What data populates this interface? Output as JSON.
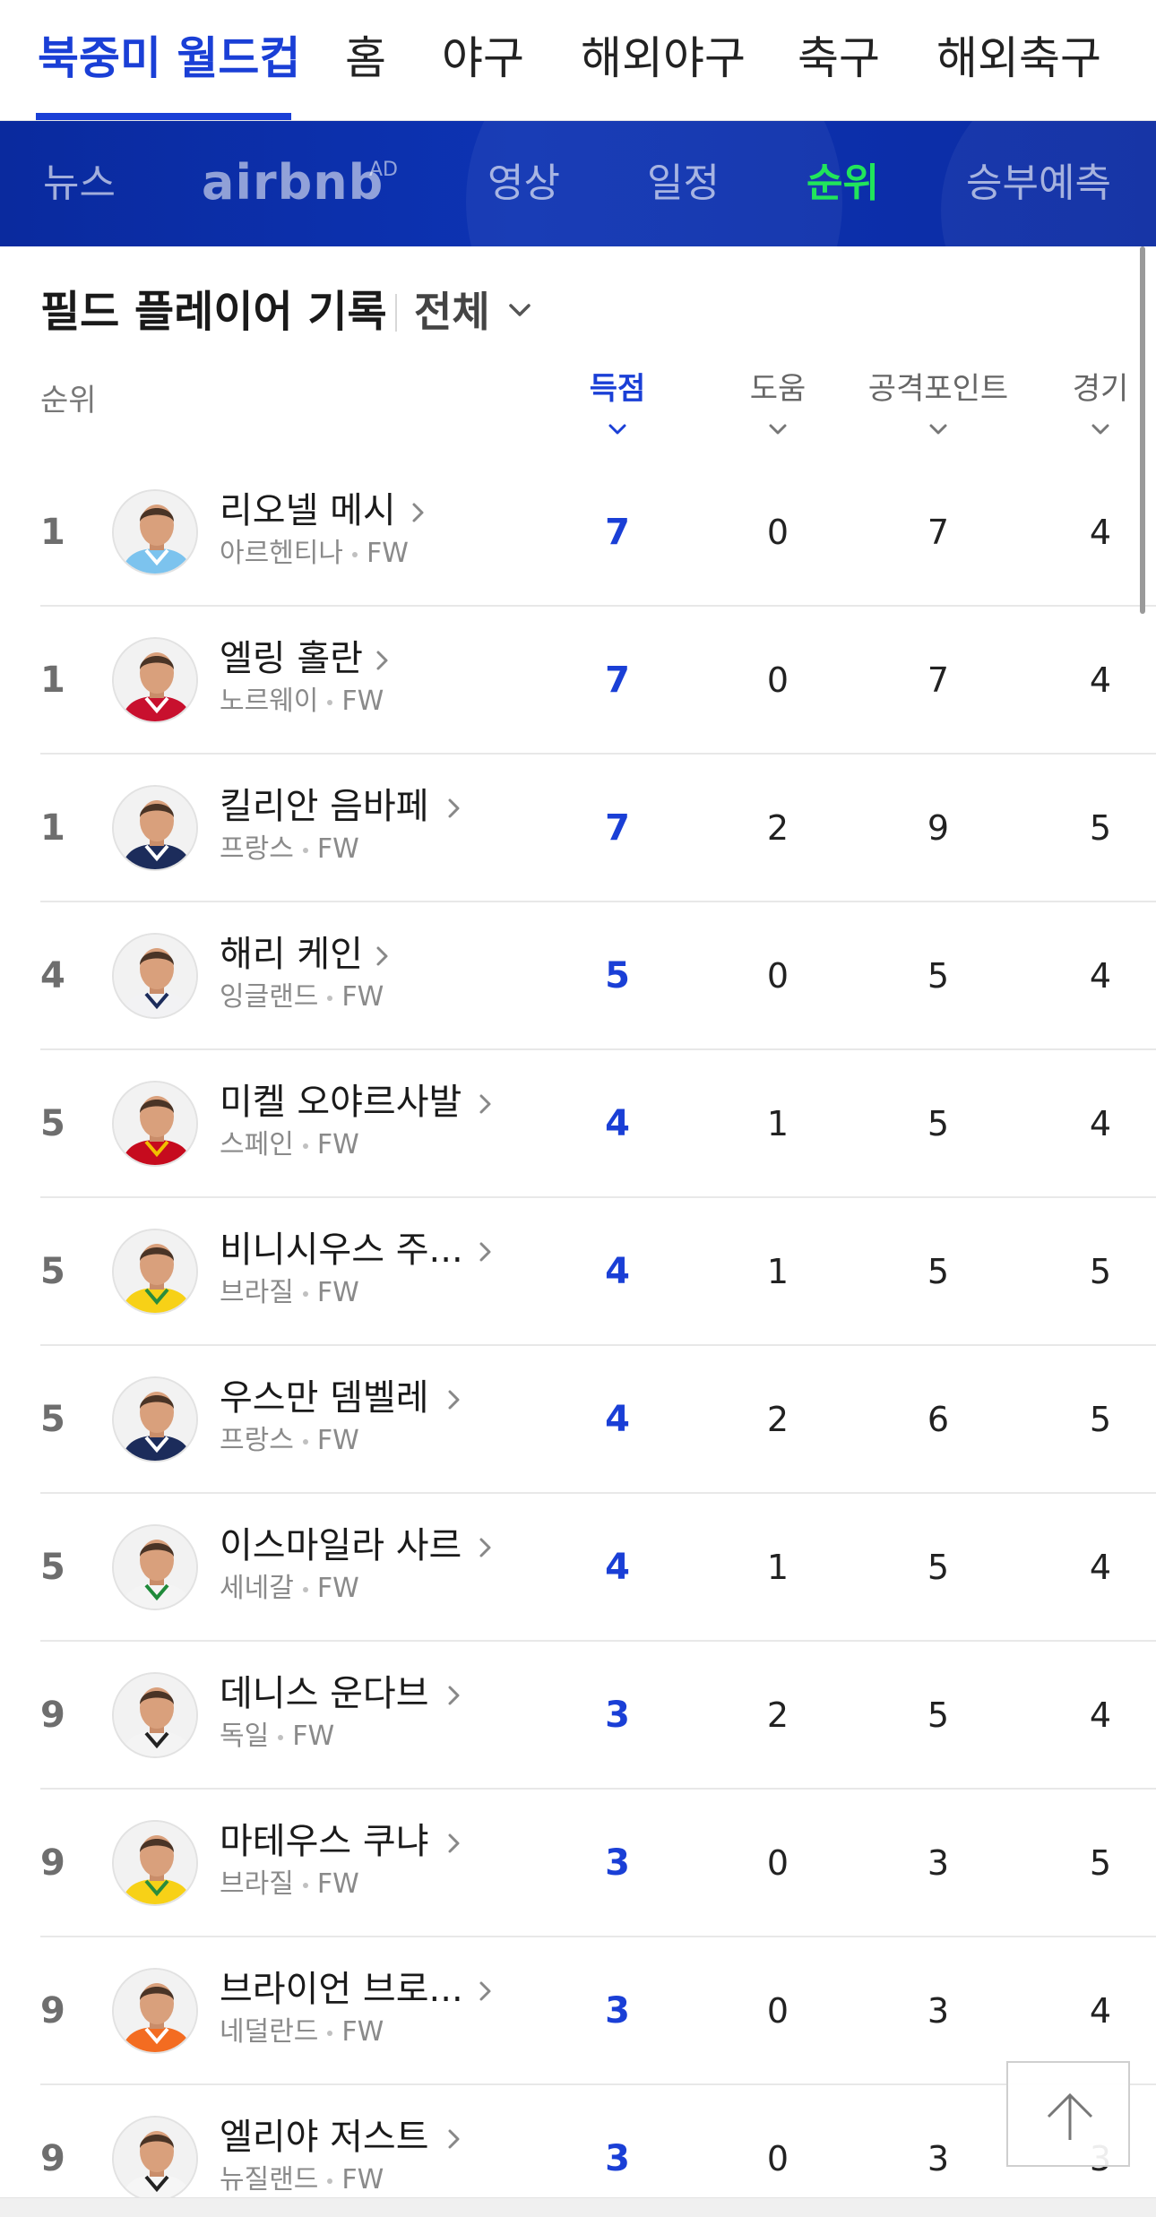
{
  "top_tabs": [
    {
      "label": "북중미 월드컵",
      "active": true
    },
    {
      "label": "홈",
      "active": false
    },
    {
      "label": "야구",
      "active": false
    },
    {
      "label": "해외야구",
      "active": false
    },
    {
      "label": "축구",
      "active": false
    },
    {
      "label": "해외축구",
      "active": false
    }
  ],
  "sub_nav": {
    "items": [
      {
        "label": "뉴스",
        "active": false
      },
      {
        "label": "영상",
        "active": false
      },
      {
        "label": "일정",
        "active": false
      },
      {
        "label": "순위",
        "active": true
      },
      {
        "label": "승부예측",
        "active": false
      }
    ],
    "sponsor": {
      "logo_text": "airbnb",
      "ad_label": "AD"
    },
    "active_color": "#21e55b"
  },
  "section": {
    "title": "필드 플레이어 기록",
    "filter_value": "전체"
  },
  "columns": {
    "rank": "순위",
    "goals": "득점",
    "assists": "도움",
    "attack_points": "공격포인트",
    "matches": "경기",
    "sorted_by": "goals"
  },
  "players": [
    {
      "rank": "1",
      "name": "리오넬 메시",
      "country": "아르헨티나",
      "position": "FW",
      "goals": "7",
      "assists": "0",
      "attack_points": "7",
      "matches": "4",
      "kit": "argentina"
    },
    {
      "rank": "1",
      "name": "엘링 홀란",
      "country": "노르웨이",
      "position": "FW",
      "goals": "7",
      "assists": "0",
      "attack_points": "7",
      "matches": "4",
      "kit": "norway"
    },
    {
      "rank": "1",
      "name": "킬리안 음바페",
      "country": "프랑스",
      "position": "FW",
      "goals": "7",
      "assists": "2",
      "attack_points": "9",
      "matches": "5",
      "kit": "france"
    },
    {
      "rank": "4",
      "name": "해리 케인",
      "country": "잉글랜드",
      "position": "FW",
      "goals": "5",
      "assists": "0",
      "attack_points": "5",
      "matches": "4",
      "kit": "england"
    },
    {
      "rank": "5",
      "name": "미켈 오야르사발",
      "country": "스페인",
      "position": "FW",
      "goals": "4",
      "assists": "1",
      "attack_points": "5",
      "matches": "4",
      "kit": "spain"
    },
    {
      "rank": "5",
      "name": "비니시우스 주...",
      "country": "브라질",
      "position": "FW",
      "goals": "4",
      "assists": "1",
      "attack_points": "5",
      "matches": "5",
      "kit": "brazil"
    },
    {
      "rank": "5",
      "name": "우스만 뎀벨레",
      "country": "프랑스",
      "position": "FW",
      "goals": "4",
      "assists": "2",
      "attack_points": "6",
      "matches": "5",
      "kit": "france"
    },
    {
      "rank": "5",
      "name": "이스마일라 사르",
      "country": "세네갈",
      "position": "FW",
      "goals": "4",
      "assists": "1",
      "attack_points": "5",
      "matches": "4",
      "kit": "senegal"
    },
    {
      "rank": "9",
      "name": "데니스 운다브",
      "country": "독일",
      "position": "FW",
      "goals": "3",
      "assists": "2",
      "attack_points": "5",
      "matches": "4",
      "kit": "germany"
    },
    {
      "rank": "9",
      "name": "마테우스 쿠냐",
      "country": "브라질",
      "position": "FW",
      "goals": "3",
      "assists": "0",
      "attack_points": "3",
      "matches": "5",
      "kit": "brazil"
    },
    {
      "rank": "9",
      "name": "브라이언 브로...",
      "country": "네덜란드",
      "position": "FW",
      "goals": "3",
      "assists": "0",
      "attack_points": "3",
      "matches": "4",
      "kit": "netherlands"
    },
    {
      "rank": "9",
      "name": "엘리야 저스트",
      "country": "뉴질랜드",
      "position": "FW",
      "goals": "3",
      "assists": "0",
      "attack_points": "3",
      "matches": "3",
      "kit": "newzealand"
    }
  ],
  "kit_colors": {
    "argentina": [
      "#7cc3ee",
      "#ffffff"
    ],
    "norway": [
      "#c8102e",
      "#ffffff"
    ],
    "france": [
      "#1c2c5b",
      "#ffffff"
    ],
    "england": [
      "#f2f2f4",
      "#1c2c5b"
    ],
    "spain": [
      "#c60b1e",
      "#f1bf00"
    ],
    "brazil": [
      "#f7d117",
      "#2a8c3c"
    ],
    "senegal": [
      "#f4f4f4",
      "#1f8a3a"
    ],
    "germany": [
      "#f4f4f4",
      "#222222"
    ],
    "netherlands": [
      "#f36c21",
      "#ffffff"
    ],
    "newzealand": [
      "#f6f6f6",
      "#222222"
    ]
  },
  "accent_color": "#1a3fd6",
  "icons": {
    "row_chevron": "chevron-right-icon",
    "sort_chevron": "chevron-down-icon",
    "scroll_top": "arrow-up-icon"
  }
}
